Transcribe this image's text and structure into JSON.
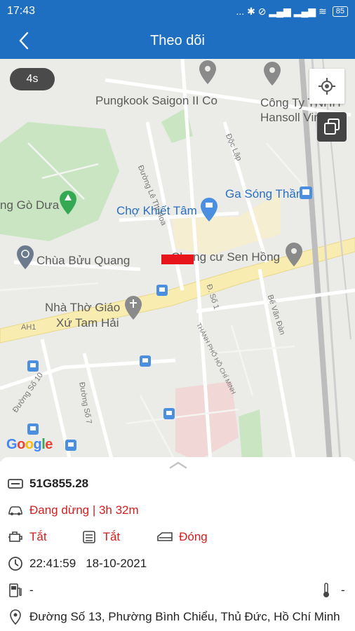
{
  "status_bar": {
    "time": "17:43",
    "icons_text": "... ✱ ⊘ ▂▄▆ ▂▄▆ ≋",
    "battery": "85"
  },
  "app_bar": {
    "title": "Theo dõi"
  },
  "map": {
    "timer": "4s",
    "labels": {
      "pungkook": "Pungkook Saigon II Co",
      "hansoll_1": "Công Ty TNHH",
      "hansoll_2": "Hansoll Vina",
      "go_dua": "ng Gò Dưa",
      "cho_khiet_tam": "Chợ Khiết Tâm",
      "ga_song_than": "Ga Sóng Thần",
      "chua_buu_quang": "Chùa Bửu Quang",
      "chung_cu": "Chung cư Sen Hồng",
      "nha_tho_1": "Nhà Thờ Giáo",
      "nha_tho_2": "Xứ Tam Hải",
      "duong_le_thi_hoa": "Đường Lê Thị Hoa",
      "doc_lap": "Độc Lập",
      "ah1": "AH1",
      "d_so_1": "Đ. Số 1",
      "be_van_dan": "Bế Văn Đàn",
      "tp_hcm": "THÀNH PHỐ HỒ CHÍ MINH",
      "duong_so_10": "Đường Số 10",
      "duong_so_7": "Đường Số 7"
    },
    "google": "Google"
  },
  "vehicle": {
    "plate": "51G855.28",
    "status": "Đang dừng | 3h 32m",
    "engine": "Tắt",
    "ac": "Tắt",
    "door": "Đóng",
    "time": "22:41:59",
    "date": "18-10-2021",
    "fuel": "-",
    "temperature": "-",
    "address": "Đường Số 13, Phường Bình Chiểu, Thủ Đức, Hồ Chí Minh"
  },
  "colors": {
    "primary": "#1e6fc1",
    "alert": "#d3201f",
    "marker": "#e8141b"
  }
}
